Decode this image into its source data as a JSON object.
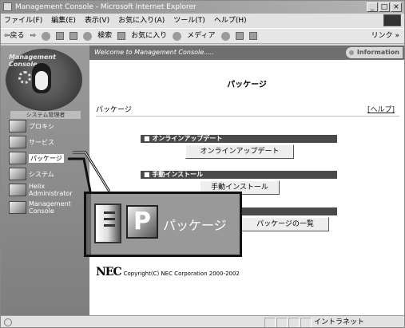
{
  "window": {
    "title": "Management Console - Microsoft Internet Explorer",
    "min": "_",
    "max": "□",
    "close": "×"
  },
  "menu": [
    "ファイル(F)",
    "編集(E)",
    "表示(V)",
    "お気に入り(A)",
    "ツール(T)",
    "ヘルプ(H)"
  ],
  "toolbar": {
    "back": "⇦戻る",
    "forward": "⇨",
    "search": "検索",
    "favorites": "お気に入り",
    "media": "メディア",
    "links": "リンク »"
  },
  "sidebar": {
    "logo_text": "Management Console",
    "system_label": "システム管理者",
    "items": [
      {
        "label": "プロキシ"
      },
      {
        "label": "サービス"
      },
      {
        "label": "パッケージ"
      },
      {
        "label": "システム"
      },
      {
        "label": "Helix Administrator"
      },
      {
        "label": "Management Console"
      }
    ]
  },
  "header": {
    "welcome": "Welcome to Management Console.....",
    "info": "Information"
  },
  "main": {
    "title": "パッケージ",
    "breadcrumb": "パッケージ",
    "help": "[ヘルプ]",
    "sections": [
      {
        "heading": "■ オンラインアップデート",
        "button": "オンラインアップデート"
      },
      {
        "heading": "■ 手動インストール",
        "button": "手動インストール"
      },
      {
        "heading": "",
        "button": "パッケージの一覧"
      }
    ],
    "nec": "NEC",
    "copyright": "Copyright(C) NEC Corporation 2000-2002"
  },
  "callout": {
    "label": "パッケージ"
  },
  "status": {
    "zone": "イントラネット"
  }
}
